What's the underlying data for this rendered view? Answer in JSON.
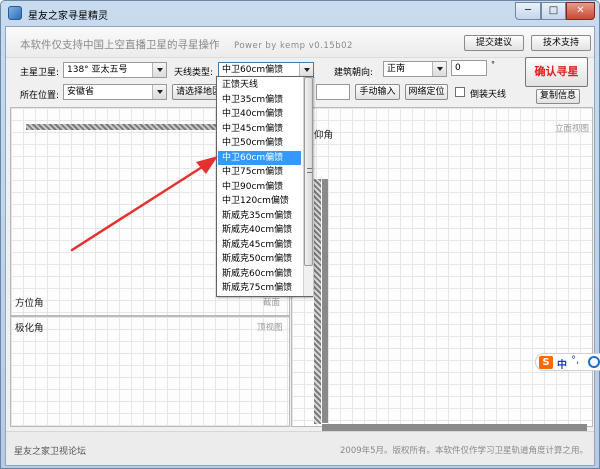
{
  "window": {
    "title": "星友之家寻星精灵",
    "min_glyph": "─",
    "max_glyph": "□",
    "close_glyph": "✕"
  },
  "header": {
    "tagline": "本软件仅支持中国上空直播卫星的寻星操作",
    "version": "Power by kemp  v0.15b02",
    "submit_label": "提交建议",
    "support_label": "技术支持"
  },
  "controls": {
    "satellite_label": "主星卫星:",
    "satellite_value": "138°  亚太五号",
    "antenna_label": "天线类型:",
    "antenna_value": "中卫60cm偏馈",
    "bearing_label": "建筑朝向:",
    "bearing_value": "正南",
    "degree_value": "0",
    "degree_sign": "°",
    "confirm_label": "确认寻星",
    "location_label": "所在位置:",
    "location_value": "安徽省",
    "region_button": "请选择地区",
    "manual_input_label": "手动输入",
    "net_locate_label": "网络定位",
    "inverted_label": "倒装天线",
    "copy_label": "复制信息"
  },
  "antenna_options": [
    {
      "label": "正馈天线",
      "selected": false
    },
    {
      "label": "中卫35cm偏馈",
      "selected": false
    },
    {
      "label": "中卫40cm偏馈",
      "selected": false
    },
    {
      "label": "中卫45cm偏馈",
      "selected": false
    },
    {
      "label": "中卫50cm偏馈",
      "selected": false
    },
    {
      "label": "中卫60cm偏馈",
      "selected": true
    },
    {
      "label": "中卫75cm偏馈",
      "selected": false
    },
    {
      "label": "中卫90cm偏馈",
      "selected": false
    },
    {
      "label": "中卫120cm偏馈",
      "selected": false
    },
    {
      "label": "斯威克35cm偏馈",
      "selected": false
    },
    {
      "label": "斯威克40cm偏馈",
      "selected": false
    },
    {
      "label": "斯威克45cm偏馈",
      "selected": false
    },
    {
      "label": "斯威克50cm偏馈",
      "selected": false
    },
    {
      "label": "斯威克60cm偏馈",
      "selected": false
    },
    {
      "label": "斯威克75cm偏馈",
      "selected": false
    }
  ],
  "panels": {
    "azimuth_title": "方位角",
    "azimuth_tag": "截面",
    "polar_title": "极化角",
    "polar_tag": "顶视图",
    "elevation_title": "仰角",
    "elevation_tag": "立面视图"
  },
  "status": {
    "left": "星友之家卫视论坛",
    "right": "2009年5月。版权所有。本软件仅作学习卫星轨道角度计算之用。"
  },
  "ime": {
    "logo": "S",
    "lang": "中",
    "punct": "°,"
  },
  "colors": {
    "confirm_text": "#e02020",
    "selection": "#3399ff",
    "annotation_arrow": "#e53030",
    "ime_logo": "#ff6a00"
  }
}
